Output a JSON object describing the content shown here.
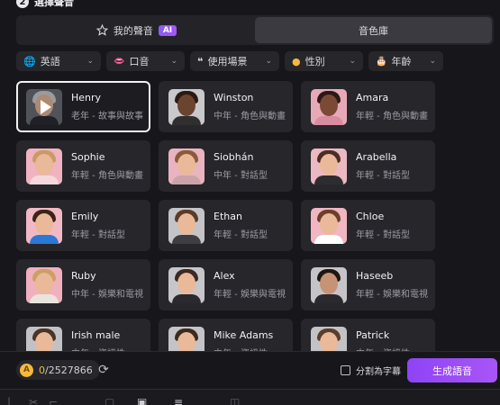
{
  "header": {
    "step": "2",
    "title": "選擇聲音"
  },
  "tabs": [
    {
      "label": "我的聲音",
      "badge": "AI"
    },
    {
      "label": "音色庫"
    }
  ],
  "filters": [
    {
      "label": "英語",
      "icon": "globe-icon"
    },
    {
      "label": "口音",
      "icon": "lips-icon"
    },
    {
      "label": "使用場景",
      "icon": "quote-icon"
    },
    {
      "label": "性別",
      "icon": "person-icon"
    },
    {
      "label": "年齡",
      "icon": "cake-icon"
    }
  ],
  "voices": [
    {
      "name": "Henry",
      "desc": "老年 - 故事與故事"
    },
    {
      "name": "Winston",
      "desc": "中年 - 角色與動畫"
    },
    {
      "name": "Amara",
      "desc": "年輕 - 角色與動畫"
    },
    {
      "name": "Sophie",
      "desc": "年輕 - 角色與動畫"
    },
    {
      "name": "Siobhán",
      "desc": "中年 - 對話型"
    },
    {
      "name": "Arabella",
      "desc": "年輕 - 對話型"
    },
    {
      "name": "Emily",
      "desc": "年輕 - 對話型"
    },
    {
      "name": "Ethan",
      "desc": "年輕 - 對話型"
    },
    {
      "name": "Chloe",
      "desc": "年輕 - 對話型"
    },
    {
      "name": "Ruby",
      "desc": "中年 - 娛樂和電視"
    },
    {
      "name": "Alex",
      "desc": "年輕 - 娛樂與電視"
    },
    {
      "name": "Haseeb",
      "desc": "年輕 - 娛樂和電視"
    },
    {
      "name": "Irish male",
      "desc": "中年 - 資訊性"
    },
    {
      "name": "Mike Adams",
      "desc": "中年 - 資訊性"
    },
    {
      "name": "Patrick",
      "desc": "中年 - 資訊性"
    }
  ],
  "footer": {
    "credits_used": "0",
    "credits_total": "/2527866",
    "split_label": "分割為字幕",
    "generate_label": "生成語音"
  },
  "colors": {
    "accent": "#a855f7",
    "coin": "#f5b93c",
    "background": "#17171b",
    "card": "#26262b"
  }
}
